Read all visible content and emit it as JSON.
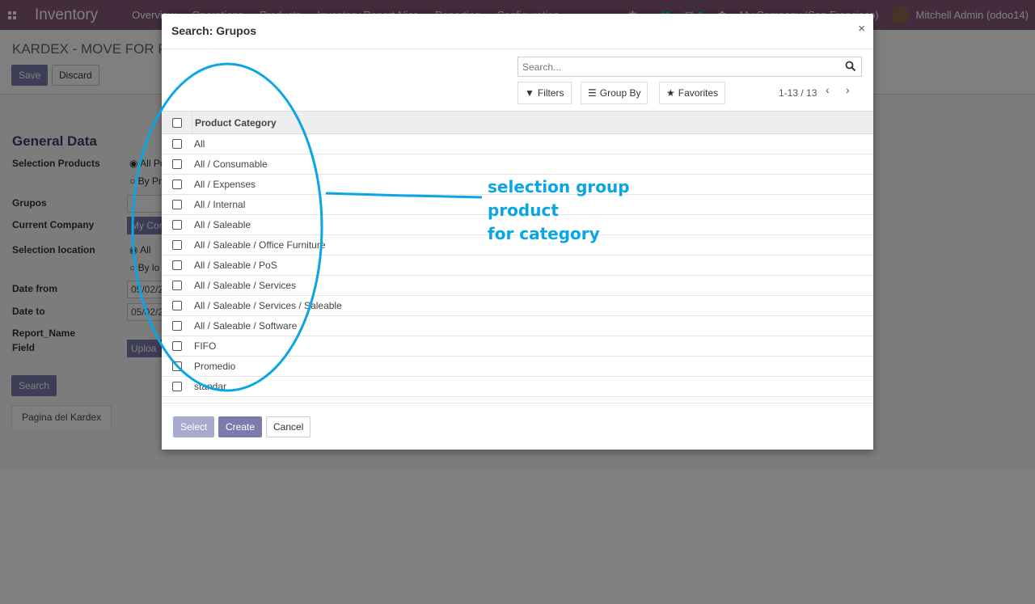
{
  "navbar": {
    "app_title": "Inventory",
    "menu": [
      "Overview",
      "Operations",
      "Products",
      "Inventory Report Nice",
      "Reporting",
      "Configuration"
    ],
    "activity_count": "13",
    "messages_count": "5",
    "company": "My Company (San Francisco)",
    "user": "Mitchell Admin (odoo14)"
  },
  "form": {
    "breadcrumb": "KARDEX - MOVE FOR PR",
    "save_label": "Save",
    "discard_label": "Discard",
    "section_title": "General Data",
    "labels": {
      "selection_products": "Selection Products",
      "grupos": "Grupos",
      "current_company": "Current Company",
      "selection_location": "Selection location",
      "date_from": "Date from",
      "date_to": "Date to",
      "report_name": "Report_Name",
      "field": "Field"
    },
    "values": {
      "all_products": "All Po",
      "by_products": "By Pr",
      "company": "My Com",
      "all": "All",
      "by_location": "By lo",
      "date_from": "05/02/2",
      "date_to": "05/02/2",
      "upload": "Uploa"
    },
    "search_label": "Search",
    "tab_label": "Pagina del Kardex"
  },
  "modal": {
    "title": "Search: Grupos",
    "search_placeholder": "Search...",
    "filters_label": "Filters",
    "groupby_label": "Group By",
    "favorites_label": "Favorites",
    "pager": "1-13 / 13",
    "column_header": "Product Category",
    "rows": [
      "All",
      "All / Consumable",
      "All / Expenses",
      "All / Internal",
      "All / Saleable",
      "All / Saleable / Office Furniture",
      "All / Saleable / PoS",
      "All / Saleable / Services",
      "All / Saleable / Services / Saleable",
      "All / Saleable / Software",
      "FIFO",
      "Promedio",
      "standar"
    ],
    "select_label": "Select",
    "create_label": "Create",
    "cancel_label": "Cancel"
  },
  "annotation": {
    "line1": "selection group product",
    "line2": "for category",
    "color": "#0aa5e3"
  },
  "colors": {
    "brand": "#875a7b",
    "primary_button": "#7c7bad"
  }
}
